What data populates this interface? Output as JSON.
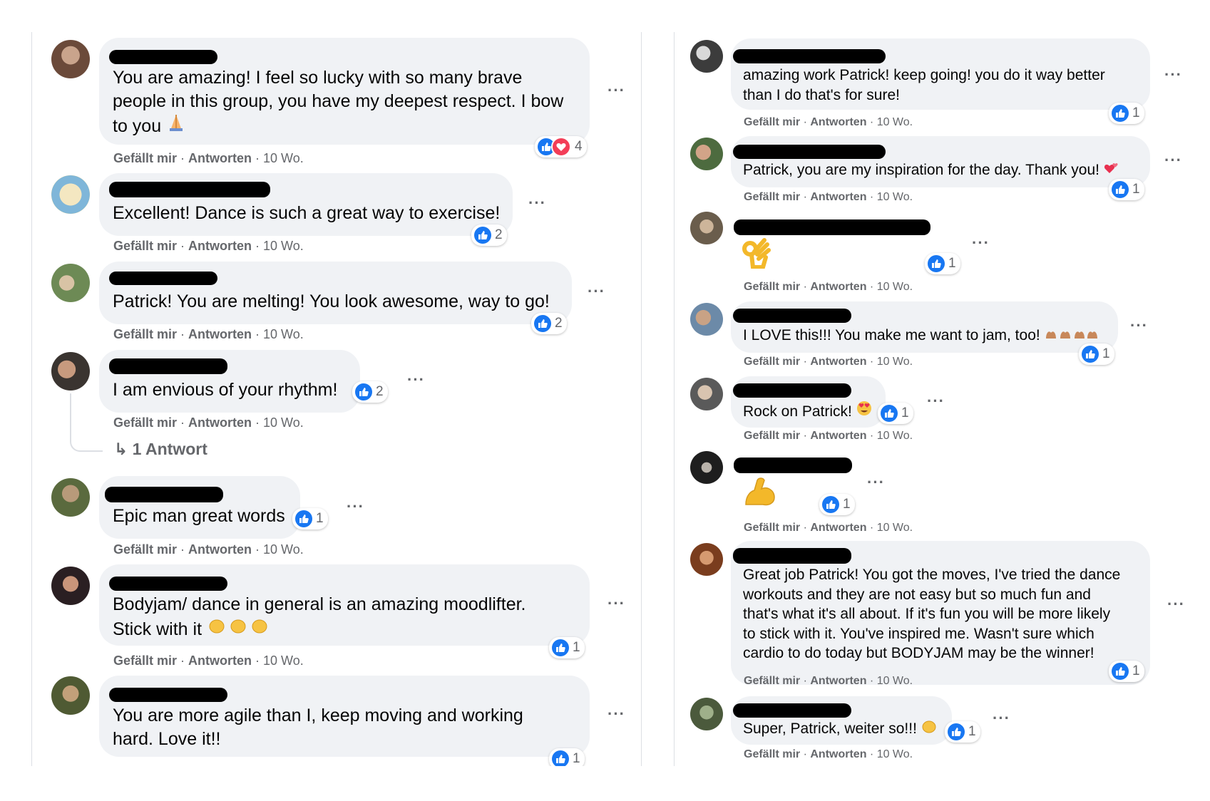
{
  "meta_strings": {
    "like": "Gefällt mir",
    "sep": " · ",
    "reply": "Antworten",
    "time": "10 Wo."
  },
  "left": {
    "c1": {
      "text": "You are amazing! I feel so lucky with so many brave\npeople in this group, you have my deepest respect. I bow\nto you",
      "reactions": "4"
    },
    "c2": {
      "text": "Excellent! Dance is such a great way to exercise!",
      "reactions": "2"
    },
    "c3": {
      "text": "Patrick! You are melting! You look awesome, way to go!",
      "reactions": "2"
    },
    "c4": {
      "text": "I am envious of your rhythm!",
      "reactions": "2",
      "reply_link": "1 Antwort"
    },
    "c5": {
      "text": "Epic man great words",
      "reactions": "1"
    },
    "c6": {
      "text": "Bodyjam/ dance in general is an amazing moodlifter.\nStick with it",
      "reactions": "1"
    },
    "c7": {
      "text": "You are more agile than I, keep moving and working\nhard. Love it!!",
      "reactions": "1"
    }
  },
  "right": {
    "r1": {
      "text": "amazing work Patrick! keep going! you do it way better\nthan I do that's for sure!",
      "reactions": "1"
    },
    "r2": {
      "text": "Patrick, you are my inspiration for the day. Thank you!",
      "reactions": "1"
    },
    "r3": {
      "text": "",
      "reactions": "1"
    },
    "r4": {
      "text": "I LOVE this!!! You make me want to jam, too!",
      "reactions": "1"
    },
    "r5": {
      "text": "Rock on Patrick!",
      "reactions": "1"
    },
    "r6": {
      "text": "",
      "reactions": "1"
    },
    "r7": {
      "text": "Great job Patrick! You got the moves, I've tried the dance\nworkouts and they are not easy but so much fun and\nthat's what it's all about. If it's fun you will be more likely\nto stick with it. You've inspired me. Wasn't sure which\ncardio to do today but BODYJAM may be the winner!",
      "reactions": "1"
    },
    "r8": {
      "text": "Super, Patrick, weiter so!!!",
      "reactions": "1"
    }
  },
  "colors": {
    "bubble": "#f0f2f5",
    "like_blue": "#1877f2",
    "love_red": "#f33e58",
    "meta_gray": "#65676b"
  },
  "icons": [
    "like-icon",
    "love-icon",
    "more-options-icon",
    "reply-arrow-icon",
    "pray-emoji",
    "clap-emoji",
    "ok-hand-emoji",
    "flexed-biceps-emoji",
    "heart-eyes-emoji",
    "hearts-emoji",
    "raising-hands-emoji"
  ]
}
